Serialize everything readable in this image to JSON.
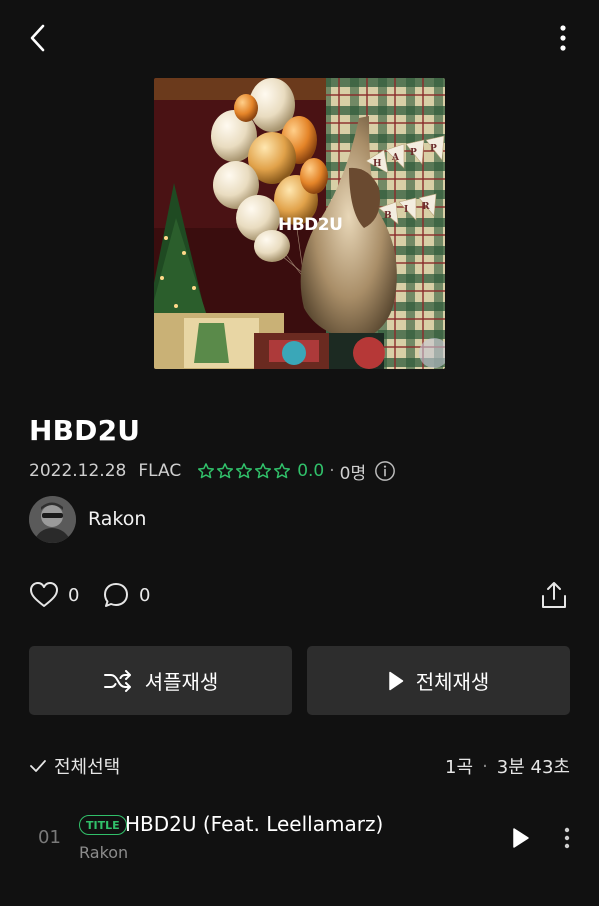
{
  "header": {
    "back_icon": "chevron-left-icon",
    "more_icon": "vertical-dots-icon"
  },
  "album": {
    "cover_text": "HBD2U",
    "title": "HBD2U",
    "release_date": "2022.12.28",
    "format": "FLAC",
    "rating": "0.0",
    "rating_count": "0명",
    "star_color": "#31c06a"
  },
  "artist": {
    "name": "Rakon"
  },
  "social": {
    "likes": "0",
    "comments": "0"
  },
  "buttons": {
    "shuffle_label": "셔플재생",
    "play_all_label": "전체재생"
  },
  "tracklist": {
    "select_all_label": "전체선택",
    "song_count": "1곡",
    "total_time": "3분 43초",
    "tracks": [
      {
        "number": "01",
        "badge": "TITLE",
        "title": "HBD2U (Feat. Leellamarz)",
        "artist": "Rakon"
      }
    ]
  }
}
